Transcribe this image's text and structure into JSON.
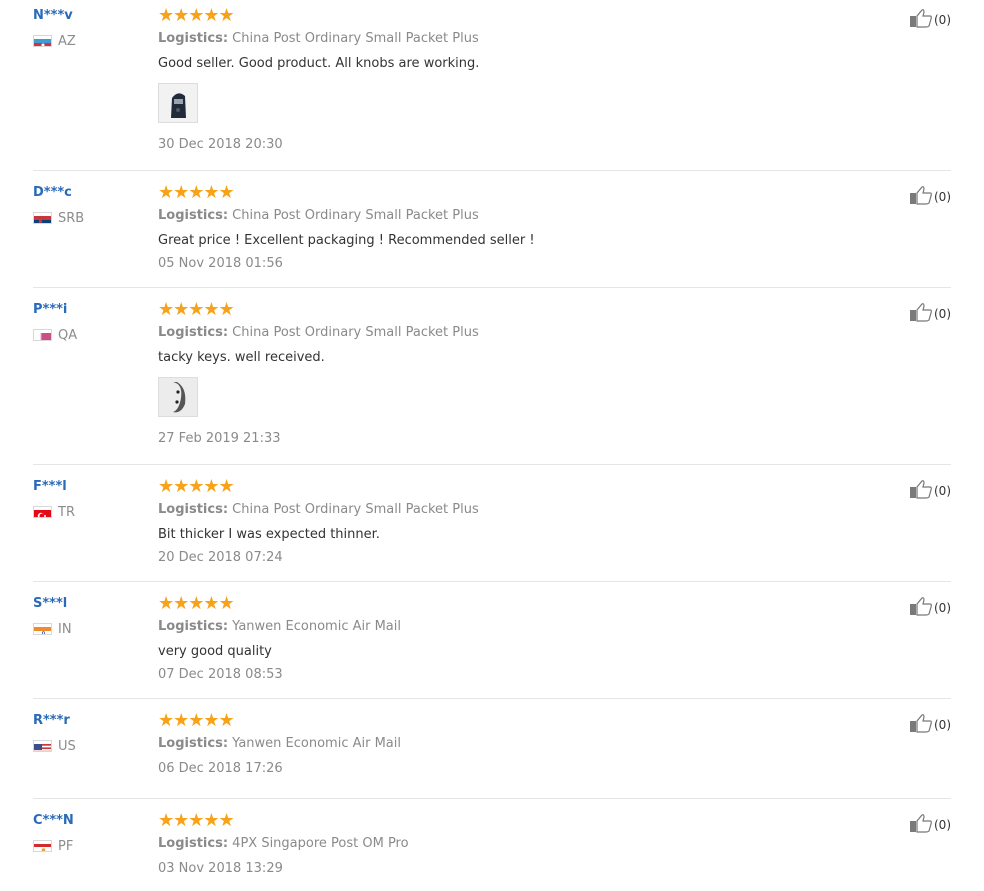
{
  "logistics_label": "Logistics:",
  "stars_glyphs": "★★★★★",
  "reviews": [
    {
      "user": "N***v",
      "country": "AZ",
      "flag_icon": "azerbaijan-flag-icon",
      "rating": 5,
      "logistics": "China Post Ordinary Small Packet Plus",
      "text": "Good seller. Good product. All knobs are working.",
      "has_photo": true,
      "photo_icon": "product-photo-thumbnail",
      "date": "30 Dec 2018 20:30",
      "helpful": "(0)"
    },
    {
      "user": "D***c",
      "country": "SRB",
      "flag_icon": "serbia-flag-icon",
      "rating": 5,
      "logistics": "China Post Ordinary Small Packet Plus",
      "text": "Great price ! Excellent packaging ! Recommended seller !",
      "has_photo": false,
      "date": "05 Nov 2018 01:56",
      "helpful": "(0)"
    },
    {
      "user": "P***i",
      "country": "QA",
      "flag_icon": "qatar-flag-icon",
      "rating": 5,
      "logistics": "China Post Ordinary Small Packet Plus",
      "text": "tacky keys. well received.",
      "has_photo": true,
      "photo_icon": "product-photo-thumbnail",
      "date": "27 Feb 2019 21:33",
      "helpful": "(0)"
    },
    {
      "user": "F***l",
      "country": "TR",
      "flag_icon": "turkey-flag-icon",
      "rating": 5,
      "logistics": "China Post Ordinary Small Packet Plus",
      "text": "Bit thicker I was expected thinner.",
      "has_photo": false,
      "date": "20 Dec 2018 07:24",
      "helpful": "(0)"
    },
    {
      "user": "S***l",
      "country": "IN",
      "flag_icon": "india-flag-icon",
      "rating": 5,
      "logistics": "Yanwen Economic Air Mail",
      "text": "very good quality",
      "has_photo": false,
      "date": "07 Dec 2018 08:53",
      "helpful": "(0)"
    },
    {
      "user": "R***r",
      "country": "US",
      "flag_icon": "usa-flag-icon",
      "rating": 5,
      "logistics": "Yanwen Economic Air Mail",
      "text": "",
      "has_photo": false,
      "date": "06 Dec 2018 17:26",
      "helpful": "(0)"
    },
    {
      "user": "C***N",
      "country": "PF",
      "flag_icon": "french-polynesia-flag-icon",
      "rating": 5,
      "logistics": "4PX Singapore Post OM Pro",
      "text": "",
      "has_photo": false,
      "date": "03 Nov 2018 13:29",
      "helpful": "(0)"
    }
  ],
  "colors": {
    "username": "#2a6ab8",
    "star": "#f7a218",
    "muted": "#8a8a8a",
    "divider": "#e5e5e5"
  }
}
